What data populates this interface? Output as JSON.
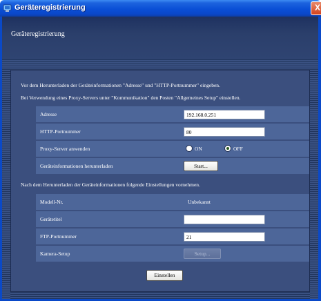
{
  "window": {
    "title": "Geräteregistrierung",
    "close_glyph": "X"
  },
  "page": {
    "title": "Geräteregistrierung"
  },
  "notes": {
    "line1": "Vor dem Herunterladen der Geräteinformationen \"Adresse\" und \"HTTP-Portnummer\" eingeben.",
    "line2": "Bei Verwendung eines Proxy-Servers unter \"Kommunikation\" den Posten \"Allgemeines Setup\" einstellen.",
    "line3": "Nach dem Herunterladen der Geräteinformationen folgende Einstellungen vornehmen."
  },
  "fields": {
    "address": {
      "label": "Adresse",
      "value": "192.168.0.251"
    },
    "http_port": {
      "label": "HTTP-Portnummer",
      "value": "80"
    },
    "proxy": {
      "label": "Proxy-Server anwenden",
      "option_on": "ON",
      "option_off": "OFF",
      "selected": "OFF"
    },
    "download": {
      "label": "Geräteinformationen herunterladen",
      "button": "Start..."
    },
    "model": {
      "label": "Modell-Nr.",
      "value": "Unbekannt"
    },
    "device_title": {
      "label": "Gerätetitel",
      "value": ""
    },
    "ftp_port": {
      "label": "FTP-Portnummer",
      "value": "21"
    },
    "camera_setup": {
      "label": "Kamera-Setup",
      "button": "Setup..."
    }
  },
  "actions": {
    "apply": "Einstellen"
  },
  "icons": {
    "app": "device-registration-icon",
    "close": "close-icon"
  },
  "colors": {
    "titlebar": "#0a4fd6",
    "panel": "#3b4f7e",
    "row": "#4d6699",
    "close": "#d4421c"
  }
}
